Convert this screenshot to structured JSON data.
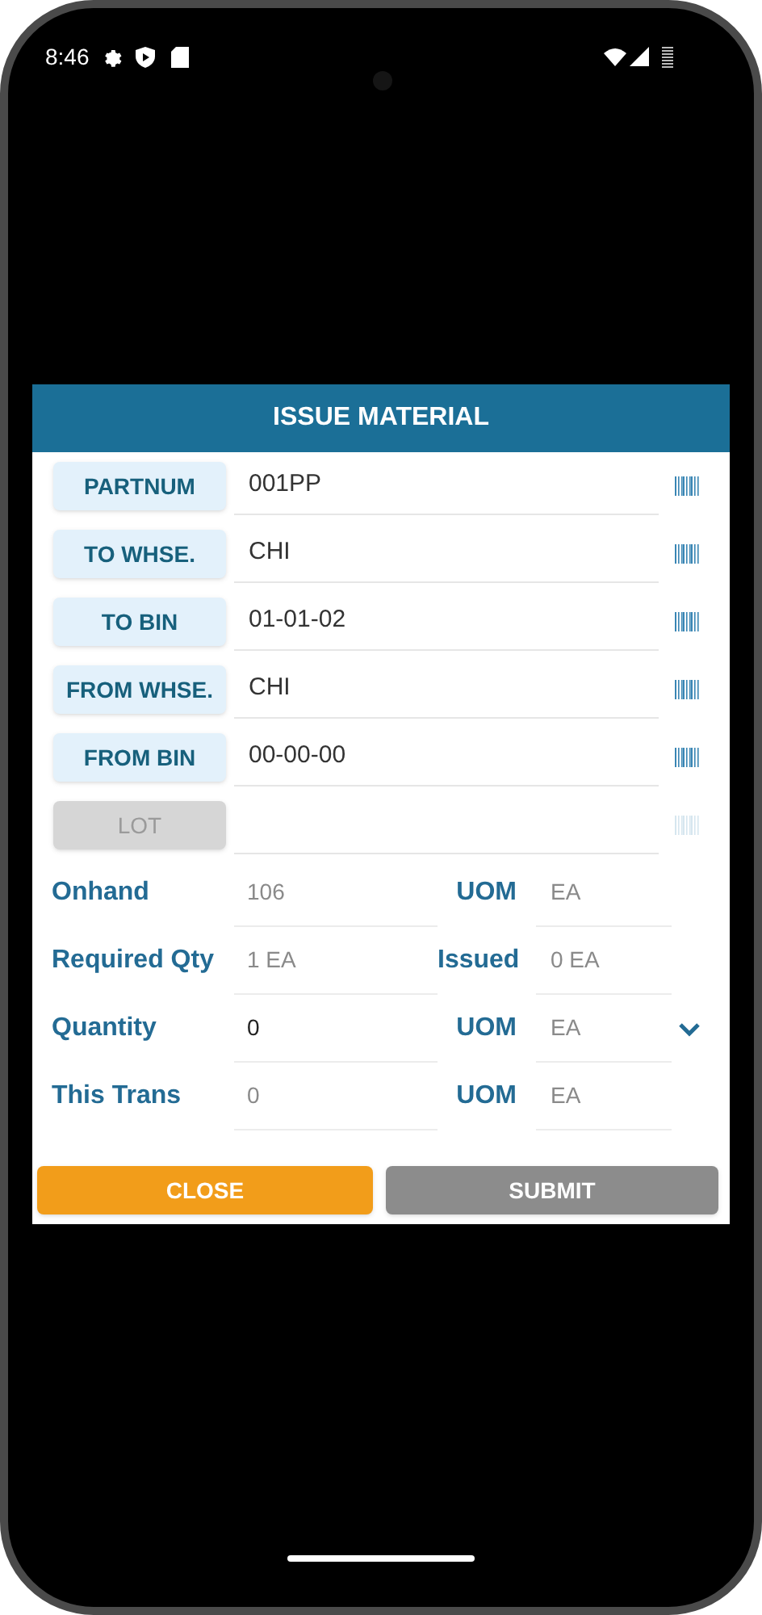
{
  "status_bar": {
    "time": "8:46"
  },
  "dialog": {
    "title": "ISSUE MATERIAL",
    "scan_fields": [
      {
        "label": "PARTNUM",
        "value": "001PP",
        "disabled": false
      },
      {
        "label": "TO WHSE.",
        "value": "CHI",
        "disabled": false
      },
      {
        "label": "TO BIN",
        "value": "01-01-02",
        "disabled": false
      },
      {
        "label": "FROM WHSE.",
        "value": "CHI",
        "disabled": false
      },
      {
        "label": "FROM BIN",
        "value": "00-00-00",
        "disabled": false
      },
      {
        "label": "LOT",
        "disabled": true
      }
    ],
    "info_rows": [
      {
        "label": "Onhand",
        "value": "106",
        "kind": "readonly",
        "unit_label": "UOM",
        "unit_value": "EA",
        "dropdown": false
      },
      {
        "label": "Required Qty",
        "value": "1 EA",
        "kind": "readonly",
        "unit_label": "Issued",
        "unit_value": "0 EA",
        "dropdown": false
      },
      {
        "label": "Quantity",
        "value": "0",
        "kind": "input",
        "unit_label": "UOM",
        "unit_value": "EA",
        "dropdown": true
      },
      {
        "label": "This Trans",
        "value": "0",
        "kind": "readonly",
        "unit_label": "UOM",
        "unit_value": "EA",
        "dropdown": false
      }
    ],
    "buttons": [
      {
        "label": "CLOSE",
        "kind": "close"
      },
      {
        "label": "SUBMIT",
        "kind": "submit"
      }
    ]
  }
}
